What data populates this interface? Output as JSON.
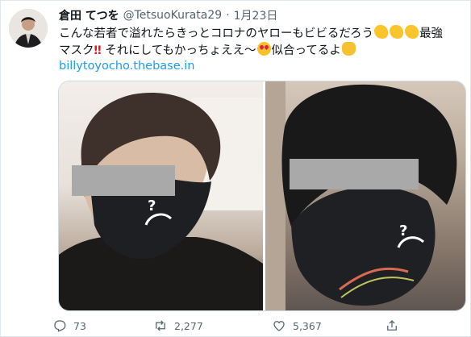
{
  "tweet": {
    "author_name": "倉田 てつを",
    "handle": "@TetsuoKurata29",
    "separator": "·",
    "date": "1月23日",
    "text_line1": "こんな若者で溢れたらきっとコロナのヤローもビビるだろう",
    "text_line1_end": "最強",
    "text_line2_start": "マスク",
    "text_line2_mid": "それにしてもかっちょええ〜",
    "text_line2_end": "似合ってるよ",
    "bang": "‼",
    "link": "billytoyocho.thebase.in",
    "mask_mark": "?"
  },
  "stats": {
    "replies": "73",
    "retweets": "2,277",
    "likes": "5,367"
  },
  "icons": [
    "reply-icon",
    "retweet-icon",
    "like-icon",
    "share-icon",
    "muscle-emoji",
    "heart-eyes-emoji",
    "thumbs-up-emoji"
  ],
  "colors": {
    "link": "#1d9bf0",
    "text": "#0f1419",
    "secondary": "#536471",
    "mask": "#1e1f22",
    "censor": "#a9a9a9"
  }
}
